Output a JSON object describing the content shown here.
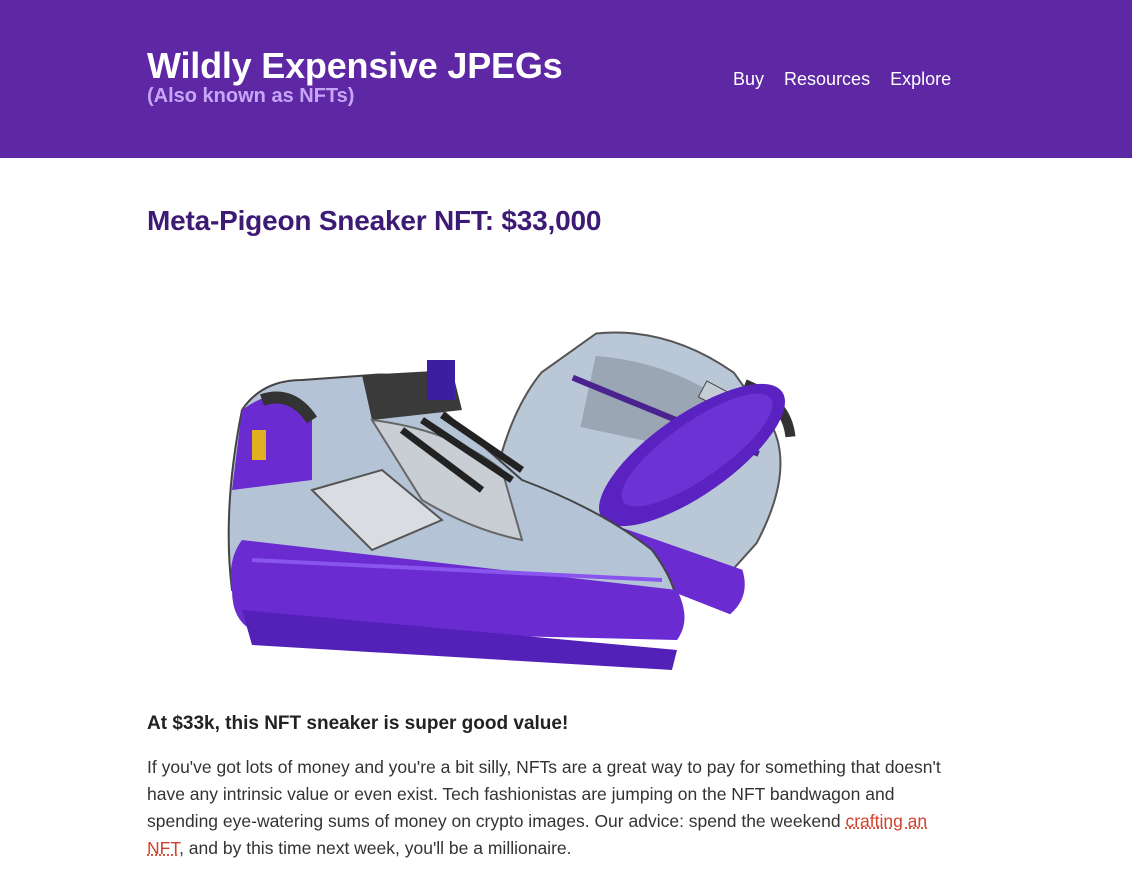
{
  "header": {
    "title": "Wildly Expensive JPEGs",
    "subtitle": "(Also known as NFTs)",
    "nav": [
      {
        "label": "Buy"
      },
      {
        "label": "Resources"
      },
      {
        "label": "Explore"
      }
    ]
  },
  "main": {
    "title": "Meta-Pigeon Sneaker NFT: $33,000",
    "lead": "At $33k, this NFT sneaker is super good value!",
    "paragraph": {
      "before_link": "If you've got lots of money and you're a bit silly, NFTs are a great way to pay for something that doesn't have any intrinsic value or even exist. Tech fashionistas are jumping on the NFT bandwagon and spending eye-watering sums of money on crypto images. Our advice: spend the weekend ",
      "link_text": "crafting an NFT",
      "after_link": ", and by this time next week, you'll be a millionaire."
    }
  },
  "colors": {
    "header_bg": "#5e27a4",
    "subtitle": "#c7a6f7",
    "heading": "#3d1a74",
    "link": "#d2412c",
    "sole": "#6a2bd0"
  },
  "image": {
    "icon": "sneaker-pair-image"
  }
}
